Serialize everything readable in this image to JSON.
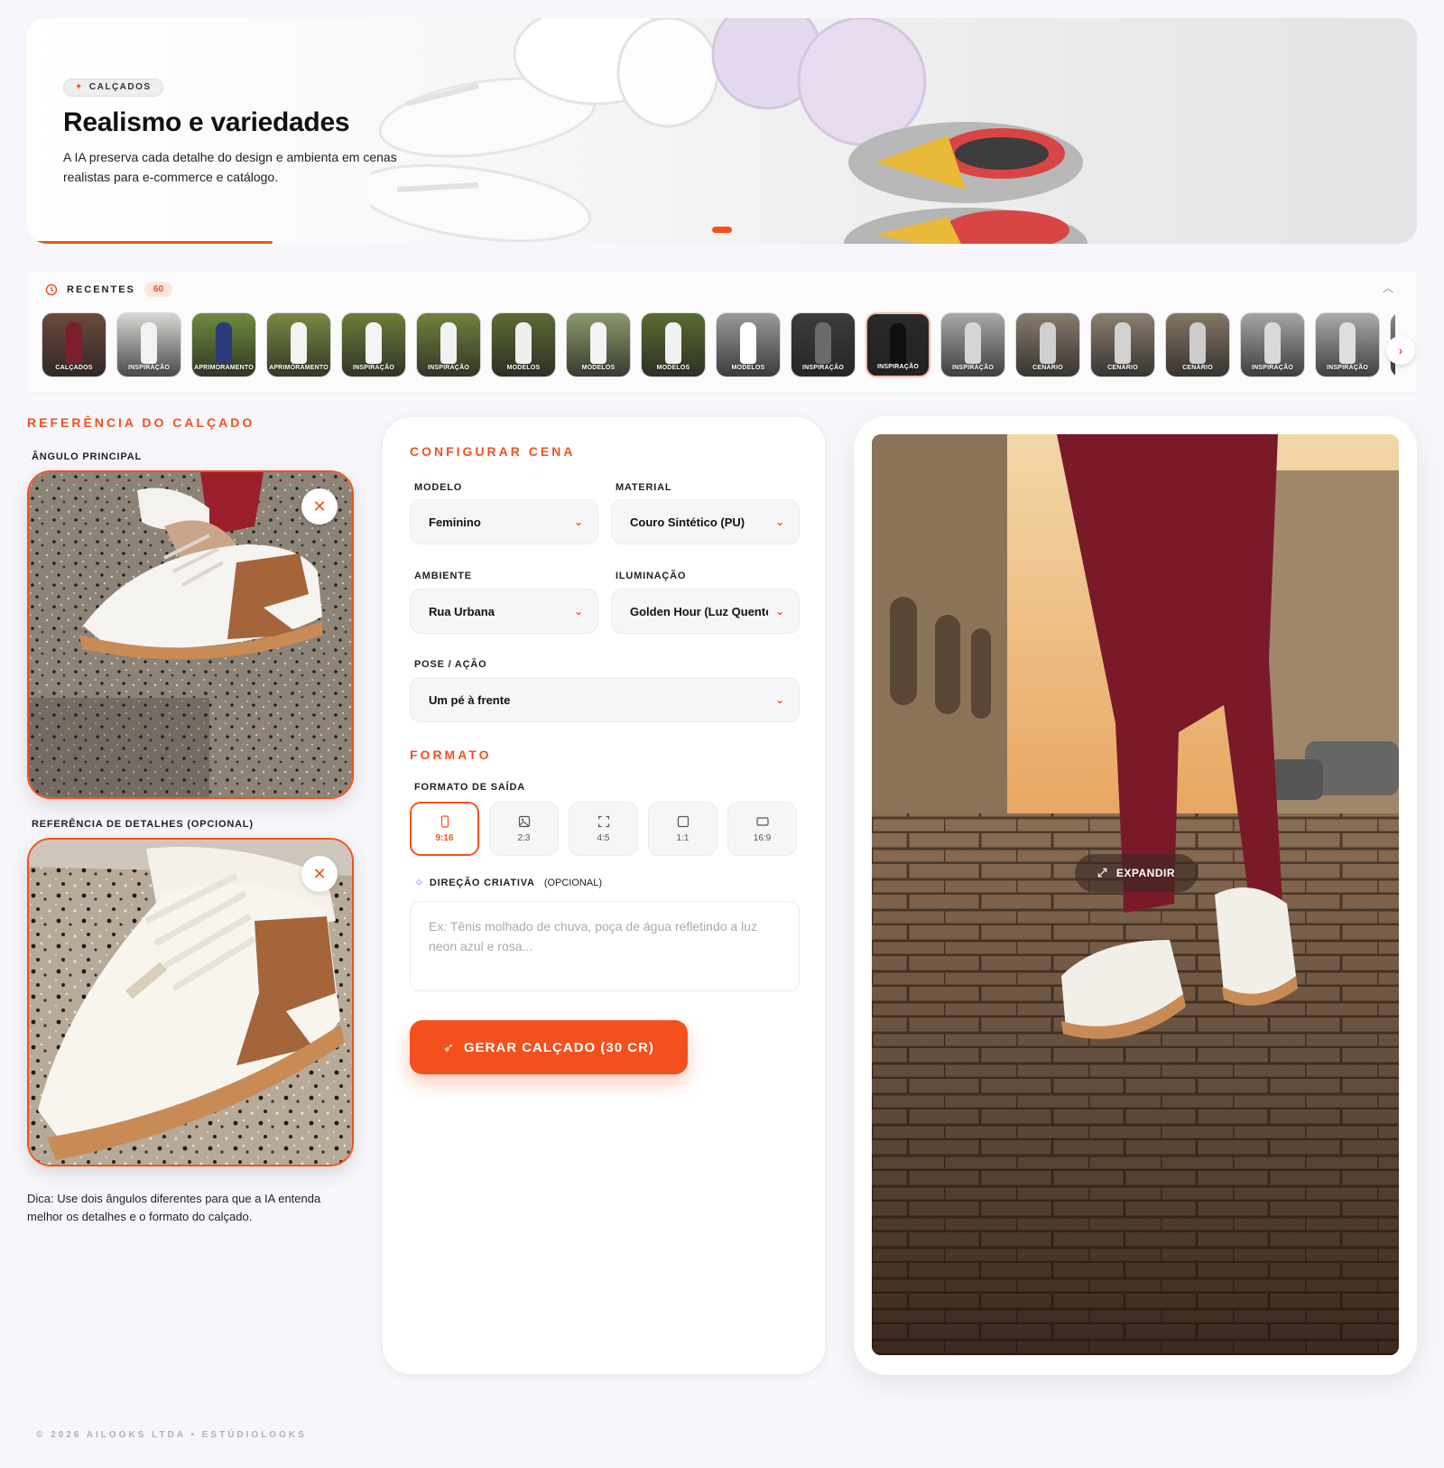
{
  "hero": {
    "badge": "CALÇADOS",
    "title": "Realismo e variedades",
    "description": "A IA preserva cada detalhe do design e ambienta em cenas realistas para e-commerce e catálogo.",
    "slide_progress": 0.17
  },
  "recents": {
    "title": "RECENTES",
    "count": "60",
    "items": [
      {
        "label": "CALÇADOS",
        "bg": "#6b4a3d",
        "fig": "#7d1f2a"
      },
      {
        "label": "INSPIRAÇÃO",
        "bg": "#d9d7d4",
        "fig": "#f2f2f2"
      },
      {
        "label": "APRIMORAMENTO",
        "bg": "#6f8a3e",
        "fig": "#2a3b7a"
      },
      {
        "label": "APRIMORAMENTO",
        "bg": "#7a8a44",
        "fig": "#f3f3f3"
      },
      {
        "label": "INSPIRAÇÃO",
        "bg": "#6c7d3a",
        "fig": "#f4f4f4"
      },
      {
        "label": "INSPIRAÇÃO",
        "bg": "#71823d",
        "fig": "#f2f2f2"
      },
      {
        "label": "MODELOS",
        "bg": "#5d6a34",
        "fig": "#efefef"
      },
      {
        "label": "MODELOS",
        "bg": "#8b9a6a",
        "fig": "#f3f3f3"
      },
      {
        "label": "MODELOS",
        "bg": "#5a6b32",
        "fig": "#f1f1f1"
      },
      {
        "label": "MODELOS",
        "bg": "#9a9a9a",
        "fig": "#ffffff"
      },
      {
        "label": "INSPIRAÇÃO",
        "bg": "#3c3c3c",
        "fig": "#6a6a6a"
      },
      {
        "label": "INSPIRAÇÃO",
        "bg": "#2a2a2a",
        "fig": "#0f0f0f"
      },
      {
        "label": "INSPIRAÇÃO",
        "bg": "#a9a9a9",
        "fig": "#d5d5d5"
      },
      {
        "label": "CENÁRIO",
        "bg": "#8a7b6c",
        "fig": "#cfcfcf"
      },
      {
        "label": "CENÁRIO",
        "bg": "#8c7e70",
        "fig": "#d2d2d2"
      },
      {
        "label": "CENÁRIO",
        "bg": "#857565",
        "fig": "#cccccc"
      },
      {
        "label": "INSPIRAÇÃO",
        "bg": "#a5a5a5",
        "fig": "#d9d9d9"
      },
      {
        "label": "INSPIRAÇÃO",
        "bg": "#ababab",
        "fig": "#dedede"
      },
      {
        "label": "",
        "bg": "#888888",
        "fig": "#cccccc"
      }
    ]
  },
  "reference": {
    "section_title": "REFERÊNCIA DO CALÇADO",
    "main_angle_label": "ÂNGULO PRINCIPAL",
    "detail_label": "REFERÊNCIA DE DETALHES (OPCIONAL)",
    "tip": "Dica: Use dois ângulos diferentes para que a IA entenda melhor os detalhes e o formato do calçado."
  },
  "config": {
    "section_title": "CONFIGURAR CENA",
    "fields": {
      "modelo": {
        "label": "MODELO",
        "value": "Feminino"
      },
      "material": {
        "label": "MATERIAL",
        "value": "Couro Sintético (PU)"
      },
      "ambiente": {
        "label": "AMBIENTE",
        "value": "Rua Urbana"
      },
      "iluminacao": {
        "label": "ILUMINAÇÃO",
        "value": "Golden Hour (Luz Quente)"
      },
      "pose": {
        "label": "POSE / AÇÃO",
        "value": "Um pé à frente"
      }
    },
    "format_title": "FORMATO",
    "output_label": "FORMATO DE SAÍDA",
    "formats": [
      {
        "label": "9:16",
        "icon": "phone-portrait-icon"
      },
      {
        "label": "2:3",
        "icon": "image-icon"
      },
      {
        "label": "4:5",
        "icon": "crop-frame-icon"
      },
      {
        "label": "1:1",
        "icon": "square-icon"
      },
      {
        "label": "16:9",
        "icon": "landscape-icon"
      }
    ],
    "selected_format": "9:16",
    "creative_label": "DIREÇÃO CRIATIVA",
    "creative_optional": "(OPCIONAL)",
    "creative_placeholder": "Ex: Tênis molhado de chuva, poça de água refletindo a luz neon azul e rosa...",
    "generate_label": "GERAR CALÇADO (30 CR)"
  },
  "result": {
    "expand_label": "EXPANDIR"
  },
  "footer": "© 2026 AILOOKS LTDA • ESTÚDIOLOOKS",
  "colors": {
    "accent": "#f4501e",
    "background": "#f7f6fa",
    "card": "#ffffff"
  }
}
